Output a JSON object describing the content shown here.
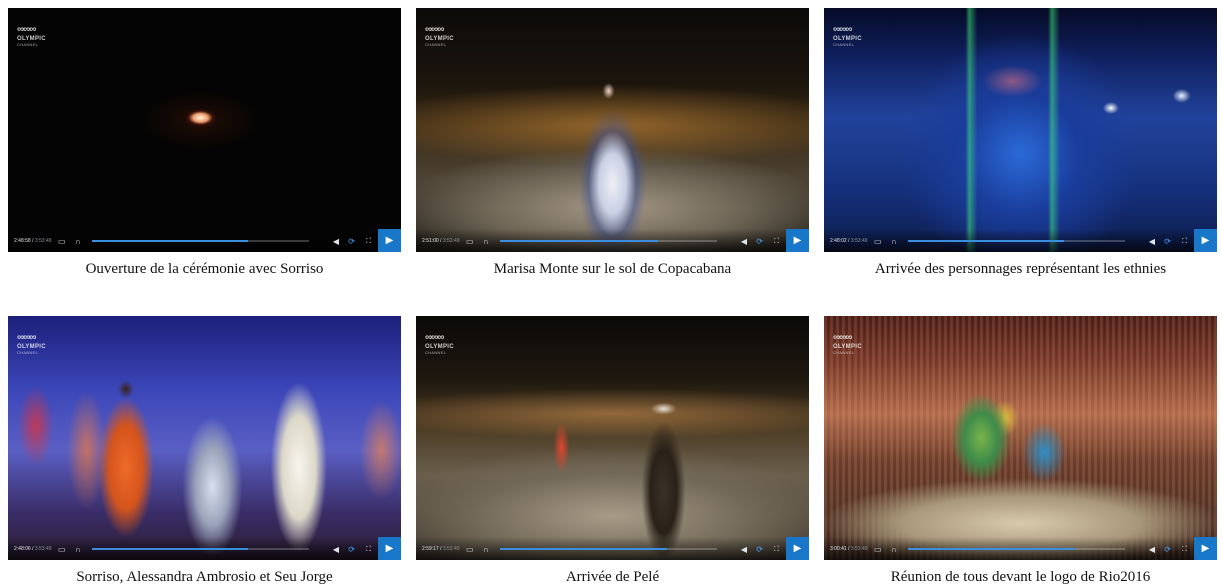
{
  "player_ui": {
    "logo_rings": "∞∞∞",
    "logo_text": "OLYMPIC",
    "logo_sub": "CHANNEL",
    "subtitles_icon": "subtitles-icon",
    "audio_icon": "headphones-icon",
    "volume_icon": "volume-icon",
    "share_icon": "share-icon",
    "fullscreen_icon": "fullscreen-icon",
    "play_icon": "play-icon",
    "accent_color": "#1877c9"
  },
  "videos": [
    {
      "caption": "Ouverture de la cérémonie avec Sorriso",
      "time": "2:48:58",
      "duration": "3:53:49",
      "progress": 0.72
    },
    {
      "caption": "Marisa Monte sur le sol de Copacabana",
      "time": "2:51:00",
      "duration": "3:53:49",
      "progress": 0.73
    },
    {
      "caption": "Arrivée des personnages représentant les ethnies",
      "time": "2:48:02",
      "duration": "3:53:49",
      "progress": 0.72
    },
    {
      "caption": "Sorriso, Alessandra Ambrosio et Seu Jorge",
      "time": "2:48:06",
      "duration": "3:53:49",
      "progress": 0.72
    },
    {
      "caption": "Arrivée de Pelé",
      "time": "2:59:17",
      "duration": "3:53:49",
      "progress": 0.77
    },
    {
      "caption": "Réunion de tous devant le logo de Rio2016",
      "time": "3:00:41",
      "duration": "3:53:49",
      "progress": 0.77
    }
  ]
}
